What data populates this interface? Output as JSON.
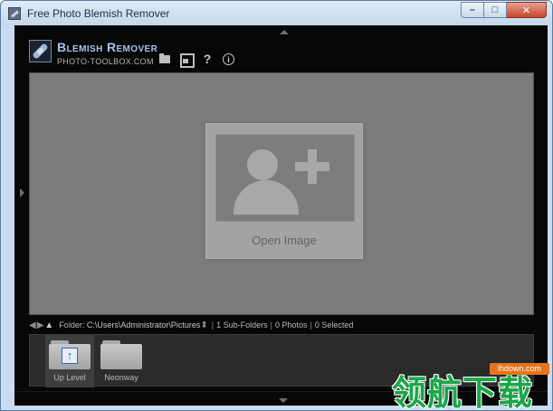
{
  "window": {
    "title": "Free Photo Blemish Remover",
    "controls": {
      "minimize": "–",
      "maximize": "□",
      "close": "✕"
    }
  },
  "brand": {
    "title": "Blemish Remover",
    "subtitle": "PHOTO-TOOLBOX.COM"
  },
  "toolbar": {
    "icons": [
      "folder-open-icon",
      "save-icon",
      "help-icon",
      "info-icon"
    ],
    "help_glyph": "?",
    "info_glyph": "i"
  },
  "canvas": {
    "open_label": "Open Image"
  },
  "pathbar": {
    "folder_label": "Folder:",
    "folder_path": "C:\\Users\\Administrator\\Pictures",
    "sort_glyph": "⬍",
    "subfolders": "1 Sub-Folders",
    "photos": "0 Photos",
    "selected": "0 Selected"
  },
  "browser": {
    "items": [
      {
        "label": "Up Level"
      },
      {
        "label": "Neonway"
      }
    ]
  },
  "watermark": {
    "domain": "lhdown.com",
    "text": "领航下载"
  },
  "colors": {
    "app_bg": "#070707",
    "canvas_bg": "#7b7b7b",
    "brand_blue": "#a5c3ee",
    "watermark_green": "#1aa64a",
    "watermark_orange": "#e8731d"
  }
}
